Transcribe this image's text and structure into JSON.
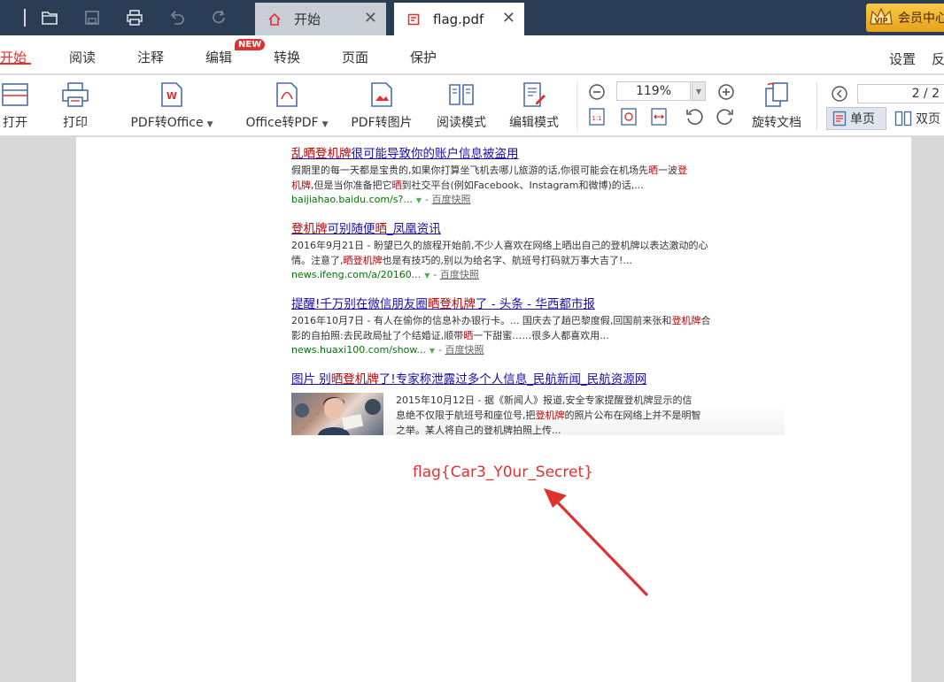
{
  "titlebar": {
    "tabs": [
      {
        "label": "开始",
        "active": false
      },
      {
        "label": "flag.pdf",
        "active": true
      }
    ],
    "vip_label": "会员中心",
    "vip_badge": "VIP"
  },
  "menu": {
    "items": [
      "开始",
      "阅读",
      "注释",
      "编辑",
      "转换",
      "页面",
      "保护"
    ],
    "active": "开始",
    "new_badge": "NEW",
    "right_items": [
      "设置",
      "反"
    ]
  },
  "toolbar": {
    "open": "打开",
    "print": "打印",
    "pdf_to_office": "PDF转Office",
    "office_to_pdf": "Office转PDF",
    "pdf_to_image": "PDF转图片",
    "read_mode": "阅读模式",
    "edit_mode": "编辑模式",
    "zoom": "119%",
    "rotate_doc": "旋转文档",
    "page_indicator": "2 / 2",
    "single_page": "单页",
    "double_page": "双页"
  },
  "results": [
    {
      "title_hl1": "乱晒登机牌",
      "title_rest": "很可能导致你的账户信息被盗用",
      "desc_parts": [
        "假期里的每一天都是宝贵的,如果你打算坐飞机去哪儿旅游的话,你很可能会在机场先",
        "晒",
        "一波",
        "登",
        "机牌",
        ",但是当你准备把它",
        "晒",
        "到社交平台(例如Facebook、Instagram和微博)的话,..."
      ],
      "url": "baijiahao.baidu.com/s?...",
      "snapshot": "百度快照"
    },
    {
      "title_hl1": "登机牌",
      "title_mid": "可别随便",
      "title_hl2": "晒",
      "title_rest": "_凤凰资讯",
      "desc_parts": [
        "2016年9月21日 - 盼望已久的旅程开始前,不少人喜欢在网络上晒出自己的登机牌以表达激动的心情。注意了,",
        "晒登机牌",
        "也是有技巧的,别以为给名字、航班号打码就万事大吉了!..."
      ],
      "url": "news.ifeng.com/a/20160...",
      "snapshot": "百度快照"
    },
    {
      "title_pre": "提醒!千万别在微信朋友圈",
      "title_hl1": "晒登机牌",
      "title_rest": "了 - 头条 - 华西都市报",
      "desc_parts": [
        "2016年10月7日 - 有人在偷你的信息补办银行卡。... 国庆去了趟巴黎度假,回国前来张和",
        "登机牌",
        "合影的自拍照:去民政局扯了个结婚证,顺带",
        "晒",
        "一下甜蜜……很多人都喜欢用..."
      ],
      "url": "news.huaxi100.com/show...",
      "snapshot": "百度快照"
    },
    {
      "title_pre": "图片 别",
      "title_hl1": "晒登机牌",
      "title_rest": "了!专家称泄露过多个人信息_民航新闻_民航资源网",
      "desc_parts": [
        "2015年10月12日 - 据《新闻人》报道,安全专家提醒登机牌显示的信息绝不仅限于航班号和座位号,把",
        "登机牌",
        "的照片公布在网络上并不是明智之举。某人将自己的登机牌拍照上传..."
      ]
    }
  ],
  "flag_text": "flag{Car3_Y0ur_Secret}",
  "colors": {
    "titlebar": "#2b3d55",
    "accent": "#e03131",
    "link": "#1a0dab",
    "highlight": "#c00000",
    "url": "#007700"
  }
}
